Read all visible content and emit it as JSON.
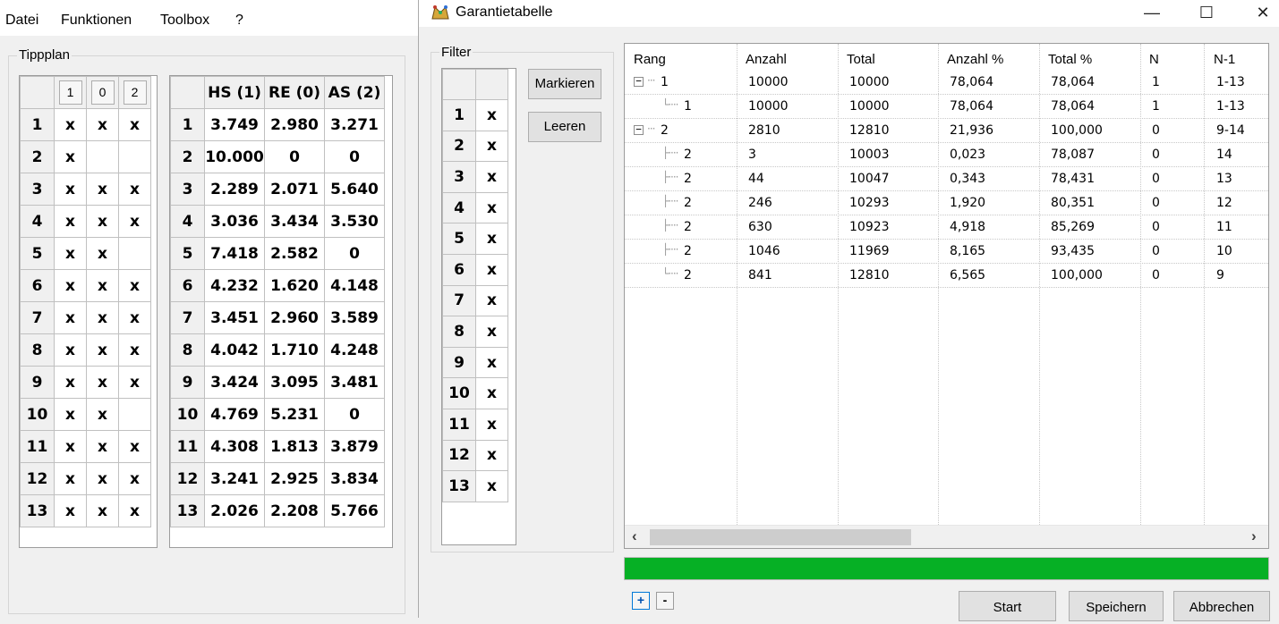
{
  "menubar": {
    "items": [
      "Datei",
      "Funktionen",
      "Toolbox",
      "?"
    ]
  },
  "tippplan": {
    "legend": "Tippplan",
    "left_header": [
      "1",
      "0",
      "2"
    ],
    "left_rows": [
      [
        "1",
        "x",
        "x",
        "x"
      ],
      [
        "2",
        "x",
        "",
        ""
      ],
      [
        "3",
        "x",
        "x",
        "x"
      ],
      [
        "4",
        "x",
        "x",
        "x"
      ],
      [
        "5",
        "x",
        "x",
        ""
      ],
      [
        "6",
        "x",
        "x",
        "x"
      ],
      [
        "7",
        "x",
        "x",
        "x"
      ],
      [
        "8",
        "x",
        "x",
        "x"
      ],
      [
        "9",
        "x",
        "x",
        "x"
      ],
      [
        "10",
        "x",
        "x",
        ""
      ],
      [
        "11",
        "x",
        "x",
        "x"
      ],
      [
        "12",
        "x",
        "x",
        "x"
      ],
      [
        "13",
        "x",
        "x",
        "x"
      ]
    ],
    "right_header": [
      "HS (1)",
      "RE (0)",
      "AS (2)"
    ],
    "right_rows": [
      [
        "1",
        "3.749",
        "2.980",
        "3.271"
      ],
      [
        "2",
        "10.000",
        "0",
        "0"
      ],
      [
        "3",
        "2.289",
        "2.071",
        "5.640"
      ],
      [
        "4",
        "3.036",
        "3.434",
        "3.530"
      ],
      [
        "5",
        "7.418",
        "2.582",
        "0"
      ],
      [
        "6",
        "4.232",
        "1.620",
        "4.148"
      ],
      [
        "7",
        "3.451",
        "2.960",
        "3.589"
      ],
      [
        "8",
        "4.042",
        "1.710",
        "4.248"
      ],
      [
        "9",
        "3.424",
        "3.095",
        "3.481"
      ],
      [
        "10",
        "4.769",
        "5.231",
        "0"
      ],
      [
        "11",
        "4.308",
        "1.813",
        "3.879"
      ],
      [
        "12",
        "3.241",
        "2.925",
        "3.834"
      ],
      [
        "13",
        "2.026",
        "2.208",
        "5.766"
      ]
    ]
  },
  "dialog": {
    "title": "Garantietabelle",
    "window_controls": {
      "minimize": "—",
      "maximize": "☐",
      "close": "✕"
    },
    "filter": {
      "legend": "Filter",
      "rows": [
        [
          "1",
          "x"
        ],
        [
          "2",
          "x"
        ],
        [
          "3",
          "x"
        ],
        [
          "4",
          "x"
        ],
        [
          "5",
          "x"
        ],
        [
          "6",
          "x"
        ],
        [
          "7",
          "x"
        ],
        [
          "8",
          "x"
        ],
        [
          "9",
          "x"
        ],
        [
          "10",
          "x"
        ],
        [
          "11",
          "x"
        ],
        [
          "12",
          "x"
        ],
        [
          "13",
          "x"
        ]
      ]
    },
    "buttons": {
      "mark": "Markieren",
      "clear": "Leeren",
      "start": "Start",
      "save": "Speichern",
      "cancel": "Abbrechen",
      "expand": "+",
      "collapse": "-"
    },
    "tree": {
      "columns": [
        "Rang",
        "Anzahl",
        "Total",
        "Anzahl %",
        "Total %",
        "N",
        "N-1"
      ],
      "rows": [
        {
          "level": 0,
          "expander": "−",
          "values": [
            "1",
            "10000",
            "10000",
            "78,064",
            "78,064",
            "1",
            "1-13"
          ]
        },
        {
          "level": 1,
          "values": [
            "1",
            "10000",
            "10000",
            "78,064",
            "78,064",
            "1",
            "1-13"
          ]
        },
        {
          "level": 0,
          "expander": "−",
          "values": [
            "2",
            "2810",
            "12810",
            "21,936",
            "100,000",
            "0",
            "9-14"
          ]
        },
        {
          "level": 1,
          "values": [
            "2",
            "3",
            "10003",
            "0,023",
            "78,087",
            "0",
            "14"
          ]
        },
        {
          "level": 1,
          "values": [
            "2",
            "44",
            "10047",
            "0,343",
            "78,431",
            "0",
            "13"
          ]
        },
        {
          "level": 1,
          "values": [
            "2",
            "246",
            "10293",
            "1,920",
            "80,351",
            "0",
            "12"
          ]
        },
        {
          "level": 1,
          "values": [
            "2",
            "630",
            "10923",
            "4,918",
            "85,269",
            "0",
            "11"
          ]
        },
        {
          "level": 1,
          "values": [
            "2",
            "1046",
            "11969",
            "8,165",
            "93,435",
            "0",
            "10"
          ]
        },
        {
          "level": 1,
          "values": [
            "2",
            "841",
            "12810",
            "6,565",
            "100,000",
            "0",
            "9"
          ]
        }
      ],
      "scroll_left": "‹",
      "scroll_right": "›"
    },
    "progress": {
      "value": 1.0,
      "color": "#06b025"
    }
  }
}
